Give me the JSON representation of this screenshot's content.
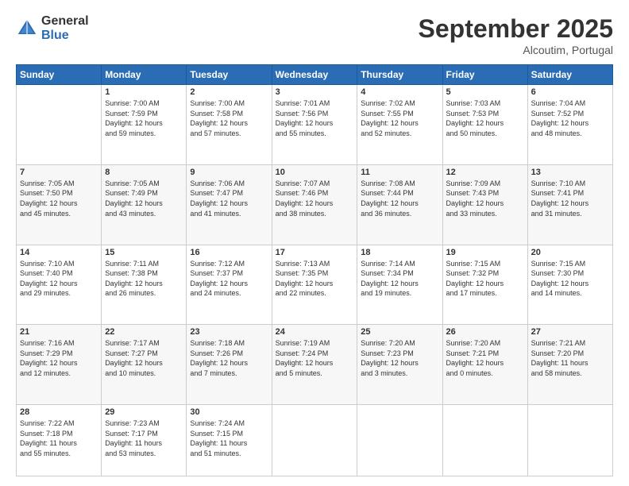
{
  "header": {
    "logo_general": "General",
    "logo_blue": "Blue",
    "month_title": "September 2025",
    "location": "Alcoutim, Portugal"
  },
  "weekdays": [
    "Sunday",
    "Monday",
    "Tuesday",
    "Wednesday",
    "Thursday",
    "Friday",
    "Saturday"
  ],
  "weeks": [
    [
      {
        "day": "",
        "info": ""
      },
      {
        "day": "1",
        "info": "Sunrise: 7:00 AM\nSunset: 7:59 PM\nDaylight: 12 hours\nand 59 minutes."
      },
      {
        "day": "2",
        "info": "Sunrise: 7:00 AM\nSunset: 7:58 PM\nDaylight: 12 hours\nand 57 minutes."
      },
      {
        "day": "3",
        "info": "Sunrise: 7:01 AM\nSunset: 7:56 PM\nDaylight: 12 hours\nand 55 minutes."
      },
      {
        "day": "4",
        "info": "Sunrise: 7:02 AM\nSunset: 7:55 PM\nDaylight: 12 hours\nand 52 minutes."
      },
      {
        "day": "5",
        "info": "Sunrise: 7:03 AM\nSunset: 7:53 PM\nDaylight: 12 hours\nand 50 minutes."
      },
      {
        "day": "6",
        "info": "Sunrise: 7:04 AM\nSunset: 7:52 PM\nDaylight: 12 hours\nand 48 minutes."
      }
    ],
    [
      {
        "day": "7",
        "info": "Sunrise: 7:05 AM\nSunset: 7:50 PM\nDaylight: 12 hours\nand 45 minutes."
      },
      {
        "day": "8",
        "info": "Sunrise: 7:05 AM\nSunset: 7:49 PM\nDaylight: 12 hours\nand 43 minutes."
      },
      {
        "day": "9",
        "info": "Sunrise: 7:06 AM\nSunset: 7:47 PM\nDaylight: 12 hours\nand 41 minutes."
      },
      {
        "day": "10",
        "info": "Sunrise: 7:07 AM\nSunset: 7:46 PM\nDaylight: 12 hours\nand 38 minutes."
      },
      {
        "day": "11",
        "info": "Sunrise: 7:08 AM\nSunset: 7:44 PM\nDaylight: 12 hours\nand 36 minutes."
      },
      {
        "day": "12",
        "info": "Sunrise: 7:09 AM\nSunset: 7:43 PM\nDaylight: 12 hours\nand 33 minutes."
      },
      {
        "day": "13",
        "info": "Sunrise: 7:10 AM\nSunset: 7:41 PM\nDaylight: 12 hours\nand 31 minutes."
      }
    ],
    [
      {
        "day": "14",
        "info": "Sunrise: 7:10 AM\nSunset: 7:40 PM\nDaylight: 12 hours\nand 29 minutes."
      },
      {
        "day": "15",
        "info": "Sunrise: 7:11 AM\nSunset: 7:38 PM\nDaylight: 12 hours\nand 26 minutes."
      },
      {
        "day": "16",
        "info": "Sunrise: 7:12 AM\nSunset: 7:37 PM\nDaylight: 12 hours\nand 24 minutes."
      },
      {
        "day": "17",
        "info": "Sunrise: 7:13 AM\nSunset: 7:35 PM\nDaylight: 12 hours\nand 22 minutes."
      },
      {
        "day": "18",
        "info": "Sunrise: 7:14 AM\nSunset: 7:34 PM\nDaylight: 12 hours\nand 19 minutes."
      },
      {
        "day": "19",
        "info": "Sunrise: 7:15 AM\nSunset: 7:32 PM\nDaylight: 12 hours\nand 17 minutes."
      },
      {
        "day": "20",
        "info": "Sunrise: 7:15 AM\nSunset: 7:30 PM\nDaylight: 12 hours\nand 14 minutes."
      }
    ],
    [
      {
        "day": "21",
        "info": "Sunrise: 7:16 AM\nSunset: 7:29 PM\nDaylight: 12 hours\nand 12 minutes."
      },
      {
        "day": "22",
        "info": "Sunrise: 7:17 AM\nSunset: 7:27 PM\nDaylight: 12 hours\nand 10 minutes."
      },
      {
        "day": "23",
        "info": "Sunrise: 7:18 AM\nSunset: 7:26 PM\nDaylight: 12 hours\nand 7 minutes."
      },
      {
        "day": "24",
        "info": "Sunrise: 7:19 AM\nSunset: 7:24 PM\nDaylight: 12 hours\nand 5 minutes."
      },
      {
        "day": "25",
        "info": "Sunrise: 7:20 AM\nSunset: 7:23 PM\nDaylight: 12 hours\nand 3 minutes."
      },
      {
        "day": "26",
        "info": "Sunrise: 7:20 AM\nSunset: 7:21 PM\nDaylight: 12 hours\nand 0 minutes."
      },
      {
        "day": "27",
        "info": "Sunrise: 7:21 AM\nSunset: 7:20 PM\nDaylight: 11 hours\nand 58 minutes."
      }
    ],
    [
      {
        "day": "28",
        "info": "Sunrise: 7:22 AM\nSunset: 7:18 PM\nDaylight: 11 hours\nand 55 minutes."
      },
      {
        "day": "29",
        "info": "Sunrise: 7:23 AM\nSunset: 7:17 PM\nDaylight: 11 hours\nand 53 minutes."
      },
      {
        "day": "30",
        "info": "Sunrise: 7:24 AM\nSunset: 7:15 PM\nDaylight: 11 hours\nand 51 minutes."
      },
      {
        "day": "",
        "info": ""
      },
      {
        "day": "",
        "info": ""
      },
      {
        "day": "",
        "info": ""
      },
      {
        "day": "",
        "info": ""
      }
    ]
  ]
}
